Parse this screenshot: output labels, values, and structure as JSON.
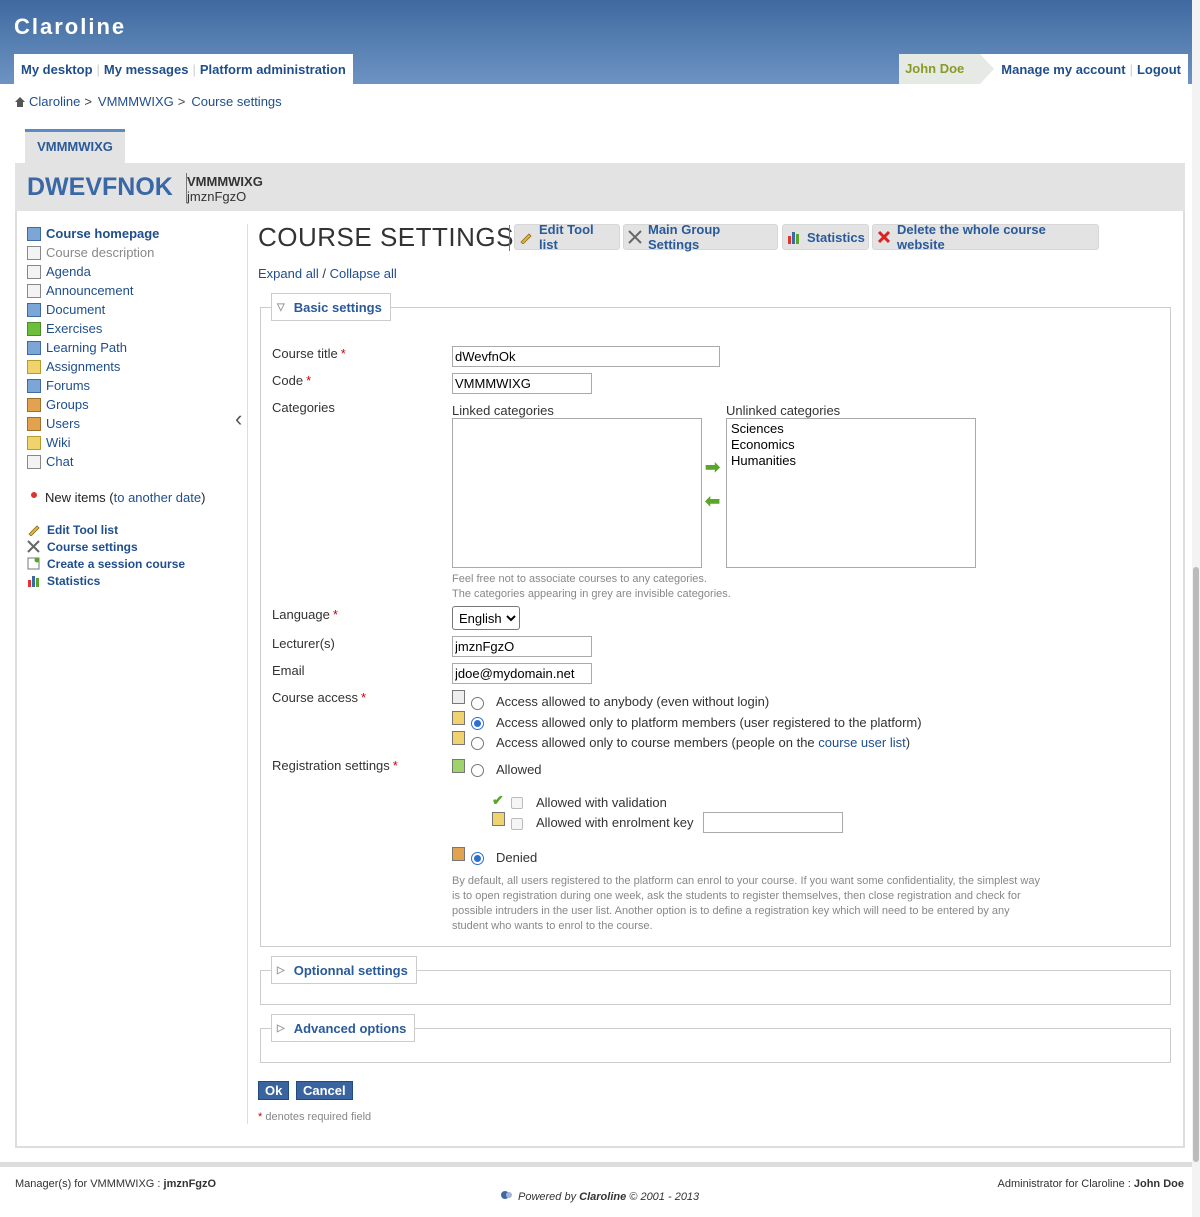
{
  "header": {
    "platform_name": "Claroline",
    "user_menu": [
      "My desktop",
      "My messages",
      "Platform administration"
    ],
    "current_user": "John Doe",
    "account_links": [
      "Manage my account",
      "Logout"
    ]
  },
  "breadcrumb": [
    "Claroline",
    "VMMMWIXG",
    "Course settings"
  ],
  "breadcrumb_sep": ">",
  "course": {
    "tab_label": "VMMMWIXG",
    "code_big": "DWEVFNOK",
    "name": "VMMMWIXG",
    "lecturer": "jmznFgzO"
  },
  "sidebar": {
    "tools": [
      "Course homepage",
      "Course description",
      "Agenda",
      "Announcement",
      "Document",
      "Exercises",
      "Learning Path",
      "Assignments",
      "Forums",
      "Groups",
      "Users",
      "Wiki",
      "Chat"
    ],
    "new_items_label": "New items (",
    "new_items_link": "to another date",
    "new_items_close": ")",
    "manager_tools": [
      "Edit Tool list",
      "Course settings",
      "Create a session course",
      "Statistics"
    ]
  },
  "page": {
    "title": "COURSE SETTINGS",
    "commands": [
      "Edit Tool list",
      "Main Group Settings",
      "Statistics",
      "Delete the whole course website"
    ],
    "expand_all": "Expand all",
    "collapse_all": "Collapse all",
    "slash": "/"
  },
  "basic": {
    "legend": "Basic settings",
    "course_title_label": "Course title",
    "course_title_value": "dWevfnOk",
    "code_label": "Code",
    "code_value": "VMMMWIXG",
    "categories_label": "Categories",
    "linked_caption": "Linked categories",
    "unlinked_caption": "Unlinked categories",
    "unlinked_options": [
      "Sciences",
      "Economics",
      "Humanities"
    ],
    "categories_help_1": "Feel free not to associate courses to any categories.",
    "categories_help_2": "The categories appearing in grey are invisible categories.",
    "language_label": "Language",
    "language_value": "English",
    "lecturers_label": "Lecturer(s)",
    "lecturers_value": "jmznFgzO",
    "email_label": "Email",
    "email_value": "jdoe@mydomain.net",
    "access_label": "Course access",
    "access_options": [
      "Access allowed to anybody (even without login)",
      "Access allowed only to platform members (user registered to the platform)",
      "Access allowed only to course members (people on the "
    ],
    "access_link": "course user list",
    "access_close": ")",
    "access_selected": 1,
    "registration_label": "Registration settings",
    "reg_allowed": "Allowed",
    "reg_validation": "Allowed with validation",
    "reg_key": "Allowed with enrolment key",
    "reg_denied": "Denied",
    "reg_help": [
      "By default, all users registered to the platform can enrol to your course. If you want some confidentiality, the simplest way",
      "is to open registration during one week, ask the students to register themselves, then close registration and check for",
      "possible intruders in the user list. Another option is to define a registration key which will need to be entered by any",
      "student who wants to enrol to the course."
    ],
    "required_mark": "*"
  },
  "optional": {
    "legend": "Optionnal settings"
  },
  "advanced": {
    "legend": "Advanced options"
  },
  "buttons": {
    "ok": "Ok",
    "cancel": "Cancel"
  },
  "required_note_star": "*",
  "required_note": " denotes required field",
  "footer": {
    "managers_prefix": "Manager(s) for VMMMWIXG : ",
    "managers_name": "jmznFgzO",
    "admin_prefix": "Administrator for Claroline : ",
    "admin_name": "John Doe",
    "powered_prefix": "Powered by ",
    "powered_brand": "Claroline",
    "powered_suffix": " © 2001 - 2013"
  }
}
